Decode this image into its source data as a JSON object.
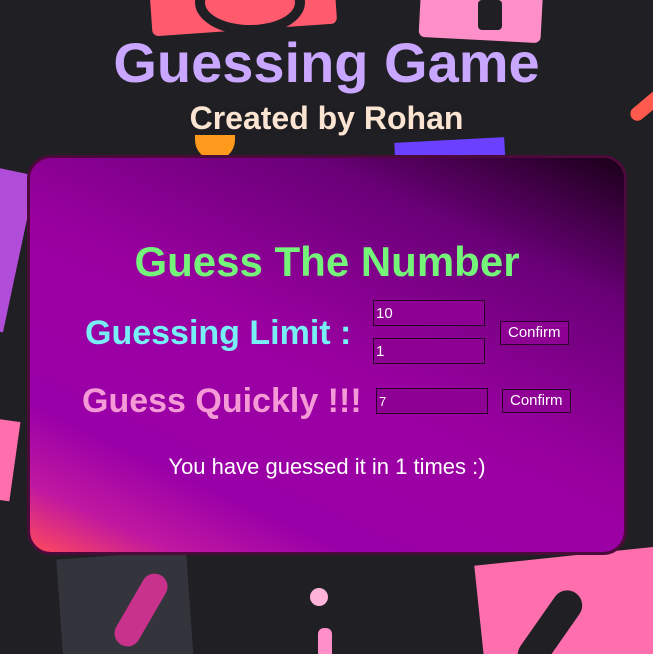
{
  "header": {
    "title": "Guessing Game",
    "subtitle": "Created by Rohan"
  },
  "card": {
    "heading": "Guess The Number",
    "limit": {
      "label": "Guessing Limit :",
      "limit_value": "10",
      "count_value": "1",
      "confirm_label": "Confirm"
    },
    "guess": {
      "label": "Guess Quickly !!!",
      "value": "7",
      "confirm_label": "Confirm"
    },
    "result": "You have guessed it in 1 times :)"
  },
  "colors": {
    "title": "#c9a6ff",
    "heading": "#74f57a",
    "limit_label": "#77f0f5",
    "quick_label": "#f59ad6",
    "background": "#1f1f24"
  }
}
